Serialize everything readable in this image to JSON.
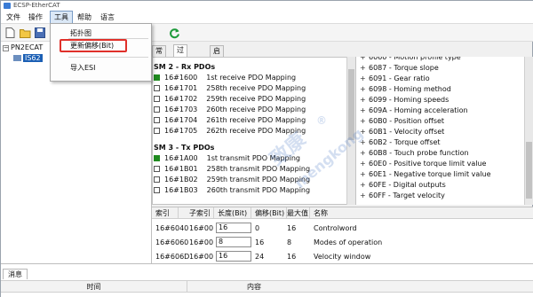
{
  "window": {
    "title": "ECSP-EtherCAT"
  },
  "menubar": [
    "文件",
    "操作",
    "工具",
    "帮助",
    "语言"
  ],
  "tools_menu": {
    "items": [
      "拓扑图",
      "更新偏移(Bit)",
      "导入ESI"
    ],
    "highlighted": "更新偏移(Bit)"
  },
  "tree": {
    "root": "PN2ECAT",
    "child": "IS62"
  },
  "tabs": [
    "常规",
    "过程数据",
    "启动信息"
  ],
  "active_tab": "过程数据",
  "sm2": {
    "title": "SM 2 - Rx PDOs",
    "rows": [
      {
        "index": "16#1600",
        "desc": "1st receive PDO Mapping",
        "checked": true
      },
      {
        "index": "16#1701",
        "desc": "258th receive PDO Mapping",
        "checked": false
      },
      {
        "index": "16#1702",
        "desc": "259th receive PDO Mapping",
        "checked": false
      },
      {
        "index": "16#1703",
        "desc": "260th receive PDO Mapping",
        "checked": false
      },
      {
        "index": "16#1704",
        "desc": "261th receive PDO Mapping",
        "checked": false
      },
      {
        "index": "16#1705",
        "desc": "262th receive PDO Mapping",
        "checked": false
      }
    ]
  },
  "sm3": {
    "title": "SM 3 - Tx PDOs",
    "rows": [
      {
        "index": "16#1A00",
        "desc": "1st transmit PDO Mapping",
        "checked": true
      },
      {
        "index": "16#1B01",
        "desc": "258th transmit PDO Mapping",
        "checked": false
      },
      {
        "index": "16#1B02",
        "desc": "259th transmit PDO Mapping",
        "checked": false
      },
      {
        "index": "16#1B03",
        "desc": "260th transmit PDO Mapping",
        "checked": false
      }
    ]
  },
  "objects": [
    "6060 - Motion profile type",
    "6087 - Torque slope",
    "6091 - Gear ratio",
    "6098 - Homing method",
    "6099 - Homing speeds",
    "609A - Homing acceleration",
    "60B0 - Position offset",
    "60B1 - Velocity offset",
    "60B2 - Torque offset",
    "60B8 - Touch probe function",
    "60E0 - Positive torque limit value",
    "60E1 - Negative torque limit value",
    "60FE - Digital outputs",
    "60FF - Target velocity"
  ],
  "detail": {
    "headers": [
      "索引",
      "子索引",
      "长度(Bit)",
      "偏移(Bit)",
      "最大值",
      "名称"
    ],
    "rows": [
      {
        "index": "16#6040",
        "sub": "16#00",
        "len": "16",
        "offset": "0",
        "max": "16",
        "name": "Controlword"
      },
      {
        "index": "16#6060",
        "sub": "16#00",
        "len": "8",
        "offset": "16",
        "max": "8",
        "name": "Modes of operation"
      },
      {
        "index": "16#606D",
        "sub": "16#00",
        "len": "16",
        "offset": "24",
        "max": "16",
        "name": "Velocity window"
      }
    ]
  },
  "messages": {
    "tab": "消息",
    "col_time": "时间",
    "col_content": "内容"
  },
  "watermark": [
    "致康",
    "mengkong",
    "®"
  ],
  "colors": {
    "accent": "#1b5fb4",
    "checked": "#1f8a1f",
    "highlight": "#e0302a"
  }
}
